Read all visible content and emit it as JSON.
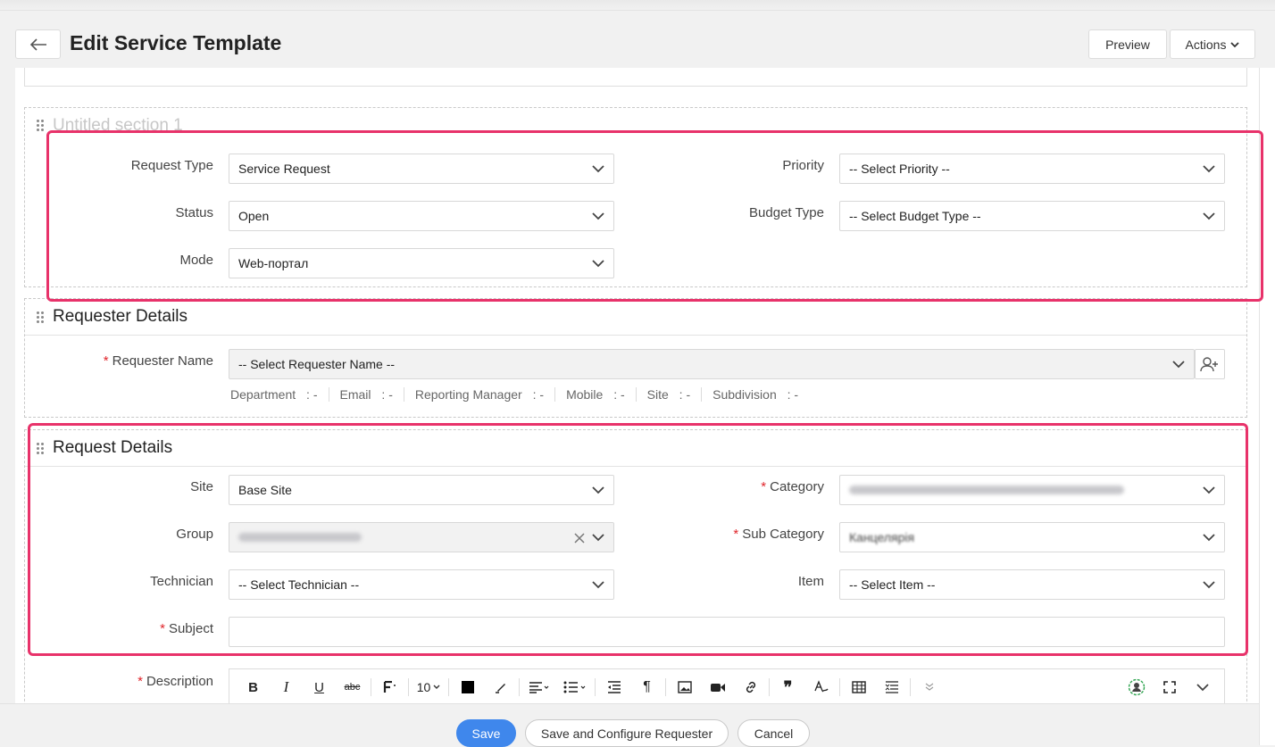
{
  "header": {
    "title": "Edit Service Template",
    "preview_label": "Preview",
    "actions_label": "Actions"
  },
  "sections": {
    "untitled": {
      "title": "Untitled section 1",
      "request_type": {
        "label": "Request Type",
        "value": "Service Request"
      },
      "priority": {
        "label": "Priority",
        "value": "-- Select Priority --"
      },
      "status": {
        "label": "Status",
        "value": "Open"
      },
      "budget_type": {
        "label": "Budget Type",
        "value": "-- Select Budget Type --"
      },
      "mode": {
        "label": "Mode",
        "value": "Web-портал"
      }
    },
    "requester": {
      "title": "Requester Details",
      "requester_name": {
        "label": "Requester Name",
        "value": "-- Select Requester Name --"
      },
      "info": [
        {
          "label": "Department",
          "sep": ":",
          "value": "-"
        },
        {
          "label": "Email",
          "sep": ":",
          "value": "-"
        },
        {
          "label": "Reporting Manager",
          "sep": ":",
          "value": "-"
        },
        {
          "label": "Mobile",
          "sep": ":",
          "value": "-"
        },
        {
          "label": "Site",
          "sep": ":",
          "value": "-"
        },
        {
          "label": "Subdivision",
          "sep": ":",
          "value": "-"
        }
      ]
    },
    "request": {
      "title": "Request Details",
      "site": {
        "label": "Site",
        "value": "Base Site"
      },
      "category": {
        "label": "Category"
      },
      "group": {
        "label": "Group"
      },
      "sub_category": {
        "label": "Sub Category",
        "value": "Канцелярія"
      },
      "technician": {
        "label": "Technician",
        "value": "-- Select Technician --"
      },
      "item": {
        "label": "Item",
        "value": "-- Select Item --"
      },
      "subject": {
        "label": "Subject",
        "value": ""
      },
      "description": {
        "label": "Description"
      }
    }
  },
  "required_marker": "*",
  "toolbar": {
    "bold": "B",
    "italic": "I",
    "underline": "U",
    "strike": "abc",
    "font_size": "10",
    "paragraph": "¶",
    "quote": "❞"
  },
  "footer": {
    "save_label": "Save",
    "save_configure_label": "Save and Configure Requester",
    "cancel_label": "Cancel"
  },
  "colors": {
    "accent": "#3f87ec",
    "highlight": "#e8326a",
    "required": "#e0252b"
  }
}
